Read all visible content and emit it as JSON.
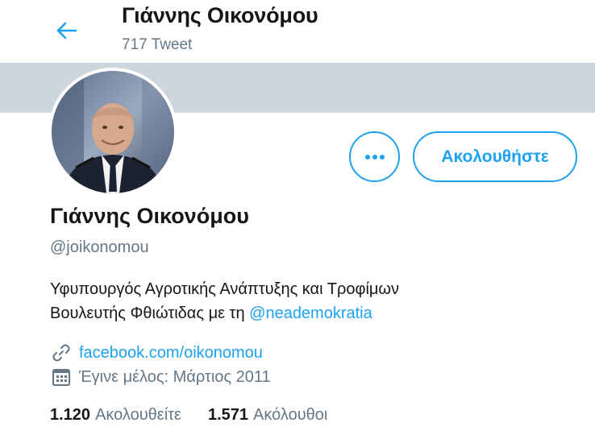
{
  "header": {
    "name": "Γιάννης Οικονόμου",
    "tweet_count": "717 Tweet"
  },
  "actions": {
    "follow_label": "Ακολουθήστε"
  },
  "profile": {
    "name": "Γιάννης Οικονόμου",
    "handle": "@joikonomou",
    "bio_line1": "Υφυπουργός Αγροτικής Ανάπτυξης και Τροφίμων",
    "bio_line2_prefix": "Βουλευτής Φθιώτιδας με τη ",
    "bio_mention": "@neademokratia",
    "website": "facebook.com/oikonomou",
    "joined": "Έγινε μέλος: Μάρτιος 2011"
  },
  "stats": {
    "following_count": "1.120",
    "following_label": "Ακολουθείτε",
    "followers_count": "1.571",
    "followers_label": "Ακόλουθοι"
  },
  "colors": {
    "accent": "#1da1f2",
    "banner": "#ccd6dd",
    "secondary_text": "#657786"
  },
  "icons": {
    "back": "arrow-left-icon",
    "more": "more-dots-icon",
    "website": "link-icon",
    "joined": "calendar-icon"
  }
}
